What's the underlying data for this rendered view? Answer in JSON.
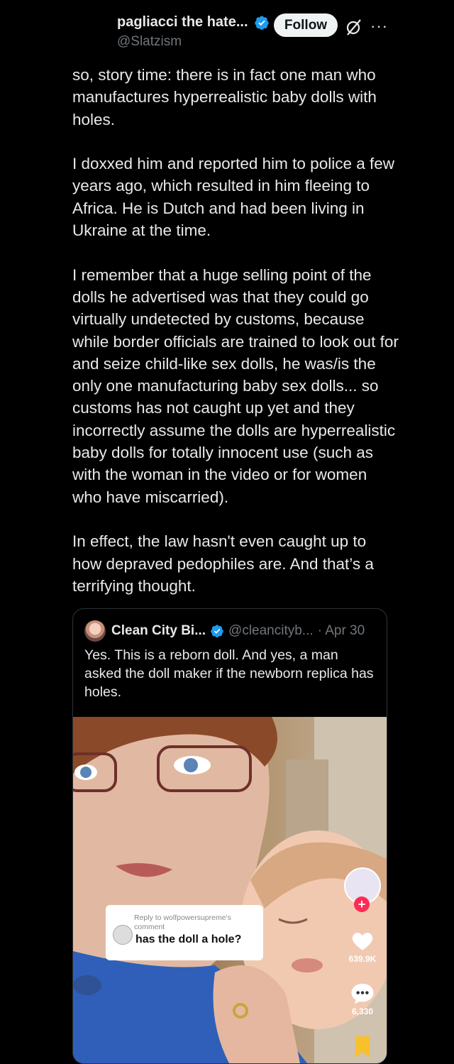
{
  "author": {
    "display_name": "pagliacci the hate...",
    "handle": "@Slatzism",
    "verified_color": "#1d9bf0"
  },
  "actions": {
    "follow_label": "Follow",
    "grok_icon": "grok-icon",
    "more_label": "···"
  },
  "tweet": {
    "text": "so, story time: there is in fact one man who manufactures hyperrealistic baby dolls with holes.\n\nI doxxed him and reported him to police a few years ago, which resulted in him fleeing to Africa. He is Dutch and had been living in Ukraine at the time.\n\nI remember that a huge selling point of the dolls he advertised was that they could go virtually undetected by customs, because while border officials are trained to look out for and seize child-like sex dolls, he was/is the only one manufacturing baby sex dolls... so customs has not caught up yet and they incorrectly assume the dolls are hyperrealistic baby dolls for totally innocent use (such as with the woman in the video or for women who have miscarried).\n\nIn effect, the law hasn't even caught up to how depraved pedophiles are. And that’s a terrifying thought."
  },
  "quote": {
    "name": "Clean City Bi...",
    "handle": "@cleancityb...",
    "date": "· Apr 30",
    "text": "Yes. This is a reborn doll. And yes, a man asked the doll maker if the newborn replica has holes.",
    "media": {
      "reply_to": "Reply to wolfpowersupreme's comment",
      "reply_question": "has the doll a hole?",
      "likes": "639.9K",
      "comments": "6,330"
    }
  }
}
